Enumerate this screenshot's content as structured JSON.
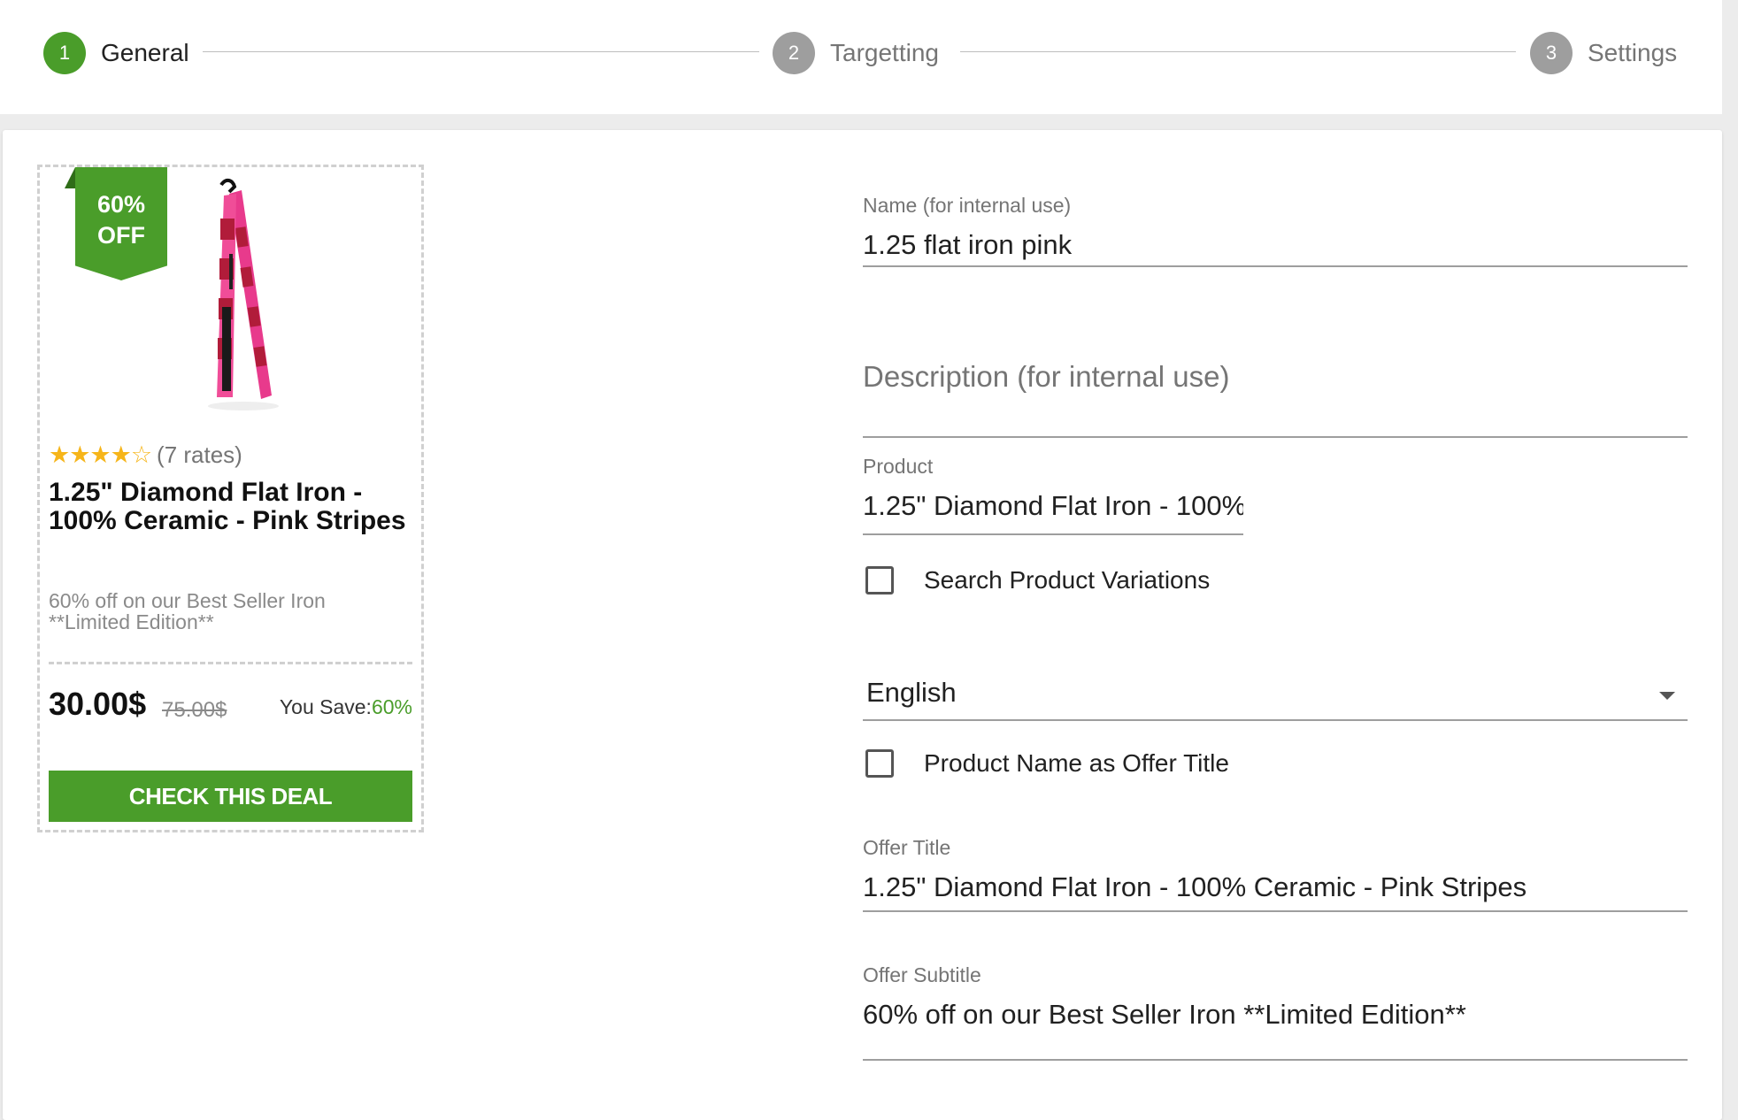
{
  "stepper": {
    "steps": [
      {
        "number": "1",
        "label": "General",
        "active": true
      },
      {
        "number": "2",
        "label": "Targetting",
        "active": false
      },
      {
        "number": "3",
        "label": "Settings",
        "active": false
      }
    ]
  },
  "preview": {
    "badge_line1": "60%",
    "badge_line2": "OFF",
    "stars": "★★★★☆",
    "rating": 4,
    "rates_text": "(7 rates)",
    "title": "1.25\" Diamond Flat Iron - 100% Ceramic - Pink Stripes",
    "subtitle_line1": "60% off on our Best Seller Iron",
    "subtitle_line2": "**Limited Edition**",
    "price": "30.00$",
    "old_price": "75.00$",
    "save_label": "You Save:",
    "save_value": "60%",
    "cta_label": "CHECK THIS DEAL"
  },
  "form": {
    "name": {
      "label": "Name (for internal use)",
      "value": "1.25 flat iron pink"
    },
    "description": {
      "placeholder": "Description (for internal use)",
      "value": ""
    },
    "product": {
      "label": "Product",
      "value": "1.25\" Diamond Flat Iron - 100%"
    },
    "search_variations": {
      "label": "Search Product Variations",
      "checked": false
    },
    "language": {
      "value": "English"
    },
    "name_as_title": {
      "label": "Product Name as Offer Title",
      "checked": false
    },
    "offer_title": {
      "label": "Offer Title",
      "value": "1.25\" Diamond Flat Iron - 100% Ceramic  - Pink Stripes"
    },
    "offer_subtitle": {
      "label": "Offer Subtitle",
      "value": "60% off on our Best Seller Iron **Limited Edition**"
    }
  },
  "colors": {
    "accent": "#4a9d2a",
    "inactive_step": "#9e9e9e",
    "star": "#f6b51a"
  }
}
